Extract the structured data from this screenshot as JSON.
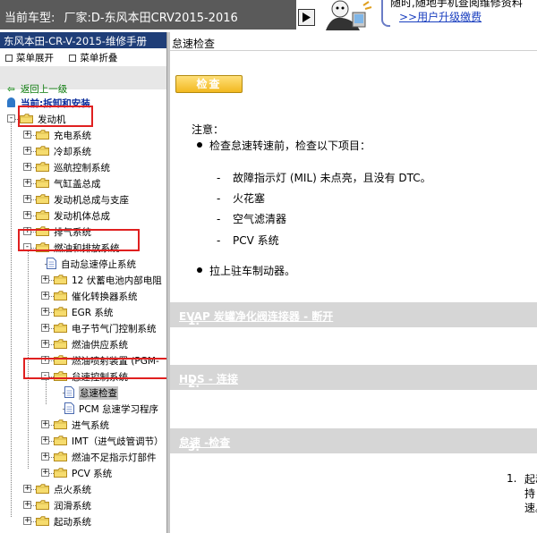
{
  "header": {
    "vehicle_label": "当前车型:",
    "vehicle_value": "厂家:D-东风本田CRV2015-2016",
    "promo_line1": "随时,随地手机查阅维修资料",
    "promo_line2": ">>用户升级缴费",
    "colors": {
      "bar": "#5a5a5a",
      "promo_link": "#1a3fbf"
    }
  },
  "sidebar": {
    "manual_title": "东风本田-CR-V-2015-维修手册",
    "expand_all": "菜单展开",
    "collapse_all": "菜单折叠",
    "back_link": "返回上一级",
    "current_location": "当前:拆卸和安装",
    "tree": [
      {
        "id": "engine",
        "label": "发动机"
      },
      {
        "id": "charging",
        "label": "充电系统"
      },
      {
        "id": "cooling",
        "label": "冷却系统"
      },
      {
        "id": "cruise",
        "label": "巡航控制系统"
      },
      {
        "id": "cyl-head",
        "label": "气缸盖总成"
      },
      {
        "id": "engine-assy",
        "label": "发动机总成与支座"
      },
      {
        "id": "engine-block",
        "label": "发动机体总成"
      },
      {
        "id": "exhaust",
        "label": "排气系统"
      },
      {
        "id": "fuel-emissions",
        "label": "燃油和排放系统"
      },
      {
        "id": "auto-idle",
        "label": "自动怠速停止系统"
      },
      {
        "id": "battery-12v",
        "label": "12 伏蓄电池内部电阻"
      },
      {
        "id": "catalytic",
        "label": "催化转换器系统"
      },
      {
        "id": "egr",
        "label": "EGR 系统"
      },
      {
        "id": "throttle",
        "label": "电子节气门控制系统"
      },
      {
        "id": "fuel-supply",
        "label": "燃油供应系统"
      },
      {
        "id": "pgm-fi",
        "label": "燃油喷射装置 (PGM-"
      },
      {
        "id": "idle-control",
        "label": "怠速控制系统"
      },
      {
        "id": "idle-check",
        "label": "怠速检查"
      },
      {
        "id": "pcm-idle",
        "label": "PCM 怠速学习程序"
      },
      {
        "id": "intake",
        "label": "进气系统"
      },
      {
        "id": "imt",
        "label": "IMT（进气歧管调节）"
      },
      {
        "id": "fuel-indicator",
        "label": "燃油不足指示灯部件"
      },
      {
        "id": "pcv",
        "label": "PCV 系统"
      },
      {
        "id": "ignition",
        "label": "点火系统"
      },
      {
        "id": "lubrication",
        "label": "润滑系统"
      },
      {
        "id": "starting",
        "label": "起动系统"
      }
    ]
  },
  "main": {
    "page_title": "怠速检查",
    "check_button": "检查",
    "note_label": "注意：",
    "bullet1": "检查怠速转速前，检查以下项目：",
    "items": [
      "故障指示灯 (MIL) 未点亮，且没有 DTC。",
      "火花塞",
      "空气滤清器",
      "PCV 系统"
    ],
    "bullet2": "拉上驻车制动器。",
    "steps": [
      {
        "text_prefix": "1. ",
        "text_link": "EVAP 炭罐净化阀连接器 - 断开"
      },
      {
        "text_prefix": "2. ",
        "text_link": "HDS - 连接"
      },
      {
        "text_prefix": "3. ",
        "text_link": "怠速 -检查"
      }
    ],
    "step1_num": "1.",
    "step1_lines": [
      "起动",
      "持",
      "速。"
    ],
    "colors": {
      "button": "#f2b820",
      "step_bar": "#d6d6d6"
    }
  }
}
